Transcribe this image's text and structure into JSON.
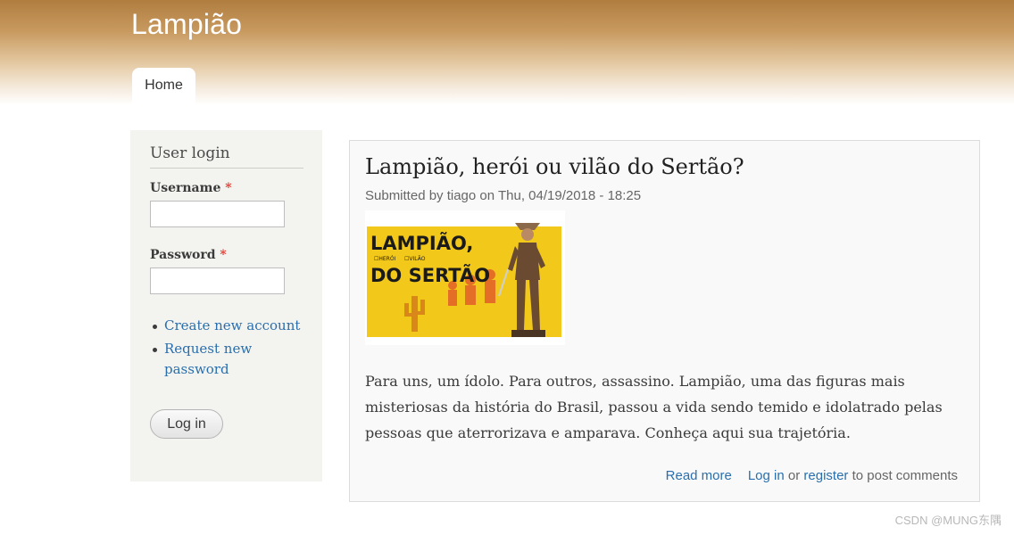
{
  "site": {
    "name": "Lampião"
  },
  "nav": {
    "tabs": [
      {
        "label": "Home"
      }
    ]
  },
  "sidebar": {
    "block_title": "User login",
    "username_label": "Username",
    "username_value": "",
    "password_label": "Password",
    "password_value": "",
    "required_marker": "*",
    "links": [
      {
        "label": "Create new account"
      },
      {
        "label": "Request new password"
      }
    ],
    "login_button": "Log in"
  },
  "node": {
    "title": "Lampião, herói ou vilão do Sertão?",
    "submitted": "Submitted by tiago on Thu, 04/19/2018 - 18:25",
    "image": {
      "headline_line1": "LAMPIÃO,",
      "option_1": "☐HERÓI",
      "option_2": "☐VILÃO",
      "headline_line2": "DO SERTÃO"
    },
    "body": "Para uns, um ídolo. Para outros, assassino. Lampião, uma das figuras mais misteriosas da história do Brasil, passou a vida sendo temido e idolatrado pelas pessoas que aterrorizava e amparava. Conheça aqui sua trajetória.",
    "links": {
      "read_more": "Read more",
      "log_in": "Log in",
      "or": "or",
      "register": "register",
      "suffix": "to post comments"
    }
  },
  "watermark": "CSDN @MUNG东隅",
  "colors": {
    "header_top": "#b07d3f",
    "link": "#2a6fad",
    "sidebar_bg": "#f3f3ef",
    "image_yellow": "#f2c81a"
  }
}
